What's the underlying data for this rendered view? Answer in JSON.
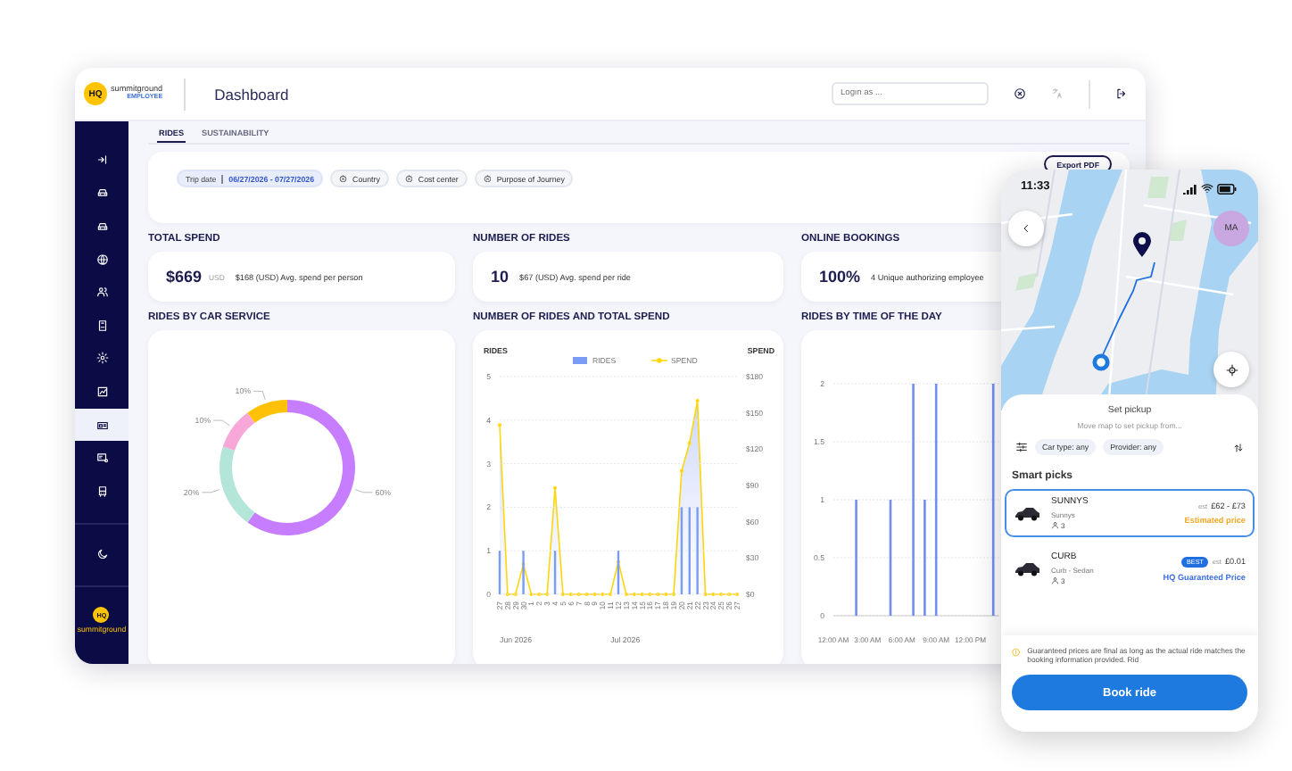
{
  "header": {
    "logo_mark": "HQ",
    "brand": "summitground",
    "brand_sub": "EMPLOYEE",
    "title": "Dashboard",
    "login_field": {
      "placeholder": "Login as ..."
    }
  },
  "sidebar": {
    "items": [
      {
        "kind": "sign-in",
        "selected": false
      },
      {
        "kind": "car",
        "selected": false
      },
      {
        "kind": "car",
        "selected": false
      },
      {
        "kind": "globe",
        "selected": false
      },
      {
        "kind": "people",
        "selected": false
      },
      {
        "kind": "badge",
        "selected": false
      },
      {
        "kind": "gear",
        "selected": false
      },
      {
        "kind": "chart",
        "selected": false
      },
      {
        "kind": "card",
        "selected": true
      },
      {
        "kind": "card-gear",
        "selected": false
      },
      {
        "kind": "bus",
        "selected": false
      }
    ],
    "footer_logo": {
      "logo_mark": "HQ",
      "brand": "summitground"
    }
  },
  "tabs": [
    {
      "label": "RIDES",
      "selected": true
    },
    {
      "label": "SUSTAINABILITY",
      "selected": false
    }
  ],
  "filters": {
    "date_label": "Trip date",
    "date_value": "06/27/2026 - 07/27/2026",
    "chips": [
      {
        "label": "Country"
      },
      {
        "label": "Cost center"
      },
      {
        "label": "Purpose of Journey"
      }
    ],
    "export_button": "Export PDF"
  },
  "kpis": [
    {
      "title": "TOTAL SPEND",
      "value": "$669",
      "unit": "USD",
      "note": "$168 (USD) Avg. spend per person"
    },
    {
      "title": "NUMBER OF RIDES",
      "value": "10",
      "note": "$67 (USD) Avg. spend per ride"
    },
    {
      "title": "ONLINE BOOKINGS",
      "value": "100%",
      "note": "4 Unique authorizing employee"
    }
  ],
  "charts": [
    {
      "title": "RIDES BY CAR SERVICE",
      "chart_data": {
        "type": "donut",
        "values": [
          60,
          20,
          10,
          10
        ],
        "colors": [
          "#c77dff",
          "#b3e5d9",
          "#f7a8d8",
          "#ffc107"
        ],
        "value_labels": [
          "60%",
          "20%",
          "10%",
          "10%"
        ]
      }
    },
    {
      "title": "NUMBER OF RIDES AND TOTAL SPEND",
      "bar_chart": {
        "chart_data": {
          "type": "bar",
          "ylabel": "RIDES",
          "grid": true,
          "categories": [
            "27",
            "28",
            "29",
            "30",
            "1",
            "2",
            "3",
            "4",
            "5",
            "6",
            "7",
            "8",
            "9",
            "10",
            "11",
            "12",
            "13",
            "14",
            "15",
            "16",
            "17",
            "18",
            "19",
            "20",
            "21",
            "22",
            "23",
            "24",
            "25",
            "26",
            "27"
          ],
          "series": [
            {
              "name": "RIDES",
              "color": "#7b9cf4",
              "values": [
                1,
                0,
                0,
                1,
                0,
                0,
                0,
                1,
                0,
                0,
                0,
                0,
                0,
                0,
                0,
                1,
                0,
                0,
                0,
                0,
                0,
                0,
                0,
                2,
                2,
                2,
                0,
                0,
                0,
                0,
                0
              ]
            }
          ],
          "ylim": [
            0,
            5
          ],
          "yticks": [
            0,
            1,
            2,
            3,
            4,
            5
          ]
        }
      },
      "area_chart": {
        "chart_data": {
          "type": "area",
          "ylabel": "SPEND",
          "series": [
            {
              "name": "SPEND",
              "color": "#ffd60a",
              "values": [
                140,
                0,
                0,
                25,
                0,
                0,
                0,
                88,
                0,
                0,
                0,
                0,
                0,
                0,
                0,
                27,
                0,
                0,
                0,
                0,
                0,
                0,
                0,
                102,
                125,
                160,
                0,
                0,
                0,
                0,
                0
              ]
            }
          ],
          "ylim": [
            0,
            180
          ],
          "yticks": [
            {
              "value": 0,
              "label": "$0"
            },
            {
              "value": 30,
              "label": "$30"
            },
            {
              "value": 60,
              "label": "$60"
            },
            {
              "value": 90,
              "label": "$90"
            },
            {
              "value": 120,
              "label": "$120"
            },
            {
              "value": 150,
              "label": "$150"
            },
            {
              "value": 180,
              "label": "$180"
            }
          ]
        }
      },
      "month_labels": [
        "Jun 2026",
        "Jul 2026"
      ]
    },
    {
      "title": "RIDES BY TIME OF THE DAY",
      "chart_data": {
        "type": "bar",
        "color": "#6f8ff2",
        "grid": true,
        "x": [
          0,
          1,
          2,
          3,
          4,
          5,
          6,
          7,
          8,
          9,
          10,
          11,
          12,
          13,
          14
        ],
        "values": [
          0,
          0,
          1,
          0,
          0,
          1,
          0,
          2,
          1,
          2,
          0,
          0,
          0,
          0,
          2
        ],
        "xlim": [
          0,
          14.5
        ],
        "ylim": [
          0,
          2
        ],
        "yticks": [
          0,
          0.5,
          1,
          1.5,
          2
        ],
        "xticks": [
          {
            "value": 0,
            "label": "12:00 AM"
          },
          {
            "value": 3,
            "label": "3:00 AM"
          },
          {
            "value": 6,
            "label": "6:00 AM"
          },
          {
            "value": 9,
            "label": "9:00 AM"
          },
          {
            "value": 12,
            "label": "12:00 PM"
          }
        ]
      }
    }
  ],
  "phone": {
    "time": "11:33",
    "avatar": "MA",
    "sheet_title": "Set pickup",
    "sheet_hint": "Move map to set pickup from...",
    "filters": [
      {
        "label": "Car type: any"
      },
      {
        "label": "Provider: any"
      }
    ],
    "section": "Smart picks",
    "options": [
      {
        "name": "SUNNYS",
        "detail": "Sunnys",
        "seats": "3",
        "prefix": "est",
        "price": "£62 - £73",
        "price_note": "Estimated price",
        "color": "#f5a623",
        "selected": true
      },
      {
        "name": "CURB",
        "detail": "Curb - Sedan",
        "seats": "3",
        "badge": "BEST",
        "prefix": "est",
        "price": "£0.01",
        "price_note": "HQ Guaranteed Price",
        "color": "#3b6fe0",
        "selected": false
      }
    ],
    "notice": "Guaranteed prices are final as long as the actual ride matches the booking information provided. Rid",
    "book_button": "Book ride"
  }
}
